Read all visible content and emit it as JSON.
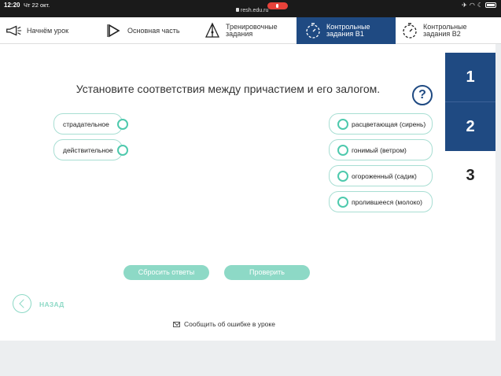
{
  "status_bar": {
    "time": "12:20",
    "date": "Чт 22 окт.",
    "url": "resh.edu.ru"
  },
  "nav": [
    {
      "label": "Начнём урок",
      "icon": "megaphone-icon"
    },
    {
      "label": "Основная часть",
      "icon": "play-icon"
    },
    {
      "label": "Тренировочные задания",
      "icon": "pyramid-icon"
    },
    {
      "label": "Контрольные задания В1",
      "icon": "stopwatch-icon",
      "active": true
    },
    {
      "label": "Контрольные задания В2",
      "icon": "stopwatch-icon"
    }
  ],
  "task": {
    "title": "Установите соответствия между причастием и его залогом.",
    "help": "?",
    "left_items": [
      "страдательное",
      "действительное"
    ],
    "right_items": [
      "расцветающая (сирень)",
      "гонимый (ветром)",
      "огороженный (садик)",
      "пролившееся (молоко)"
    ]
  },
  "buttons": {
    "reset": "Сбросить ответы",
    "check": "Проверить"
  },
  "back": {
    "label": "НАЗАД"
  },
  "report": {
    "label": "Сообщить об ошибке в уроке"
  },
  "steps": [
    {
      "number": "1",
      "state": "done"
    },
    {
      "number": "2",
      "state": "done"
    },
    {
      "number": "3",
      "state": "current"
    }
  ],
  "colors": {
    "accent": "#1f4a82",
    "teal": "#4ec9ad",
    "button": "#8dd9c6"
  }
}
